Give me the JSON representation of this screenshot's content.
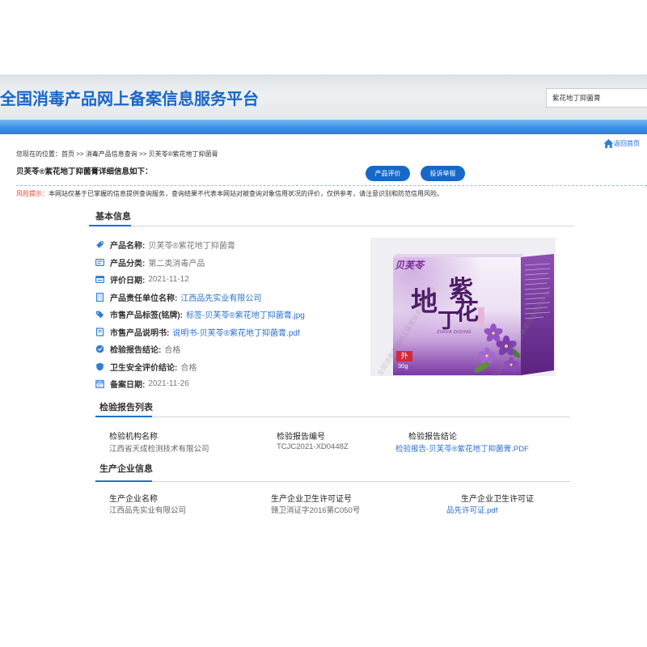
{
  "header": {
    "site_title": "全国消毒产品网上备案信息服务平台",
    "search_value": "紫花地丁抑菌膏"
  },
  "breadcrumb": {
    "prefix": "您现在的位置：",
    "home": "首页",
    "separator": ">>",
    "section": "消毒产品信息查询",
    "current": "贝芙苓®紫花地丁抑菌膏"
  },
  "return_home": {
    "label": "返回首页",
    "icon": "home-icon"
  },
  "detail": {
    "title": "贝芙苓®紫花地丁抑菌膏详细信息如下：",
    "evaluate_button": "产品评价",
    "complaint_button": "投诉举报"
  },
  "risk_notice": {
    "label": "风险提示：",
    "text": "本网站仅基于已掌握的信息提供查询服务，查询结果不代表本网站对被查询对象信用状况的评价，仅供参考，请注意识别和防范信用风险。"
  },
  "basic_info": {
    "heading": "基本信息",
    "fields": [
      {
        "icon": "tag-icon",
        "label": "产品名称:",
        "value": "贝芙苓®紫花地丁抑菌膏"
      },
      {
        "icon": "category-icon",
        "label": "产品分类:",
        "value": "第二类消毒产品"
      },
      {
        "icon": "date-icon",
        "label": "评价日期:",
        "value": "2021-11-12"
      },
      {
        "icon": "building-icon",
        "label": "产品责任单位名称:",
        "value": "江西品先实业有限公司"
      },
      {
        "icon": "label-icon",
        "label": "市售产品标签(铭牌):",
        "value": "标签-贝芙苓®紫花地丁抑菌膏.jpg"
      },
      {
        "icon": "manual-icon",
        "label": "市售产品说明书:",
        "value": "说明书-贝芙苓®紫花地丁抑菌膏.pdf"
      },
      {
        "icon": "inspection-icon",
        "label": "检验报告结论:",
        "value": "合格"
      },
      {
        "icon": "shield-icon",
        "label": "卫生安全评价结论:",
        "value": "合格"
      },
      {
        "icon": "calendar-icon",
        "label": "备案日期:",
        "value": "2021-11-26"
      }
    ]
  },
  "product_image": {
    "brand": "贝芙苓",
    "name_chars": [
      "紫",
      "花",
      "地",
      "丁"
    ],
    "pinyin": "ZIHUA DIDING",
    "usage_badge": "外",
    "net_weight": "30g",
    "watermark": "全国消毒产品网上备案信息服务平台"
  },
  "inspection_reports": {
    "heading": "检验报告列表",
    "columns": [
      "检验机构名称",
      "检验报告编号",
      "检验报告结论"
    ],
    "rows": [
      [
        "江西省天成检测技术有限公司",
        "TCJC2021-XD0448Z",
        "检验报告-贝芙苓®紫花地丁抑菌膏.PDF"
      ]
    ]
  },
  "manufacturer": {
    "heading": "生产企业信息",
    "columns": [
      "生产企业名称",
      "生产企业卫生许可证号",
      "生产企业卫生许可证"
    ],
    "rows": [
      [
        "江西品先实业有限公司",
        "赣卫消证字2016第C050号",
        "品先许可证.pdf"
      ]
    ]
  },
  "colors": {
    "brand_blue": "#1a66c8",
    "button_blue": "#1668c9",
    "link_blue": "#2a6fd0",
    "risk_red": "#e53935",
    "icon_blue": "#2f7fd4"
  }
}
